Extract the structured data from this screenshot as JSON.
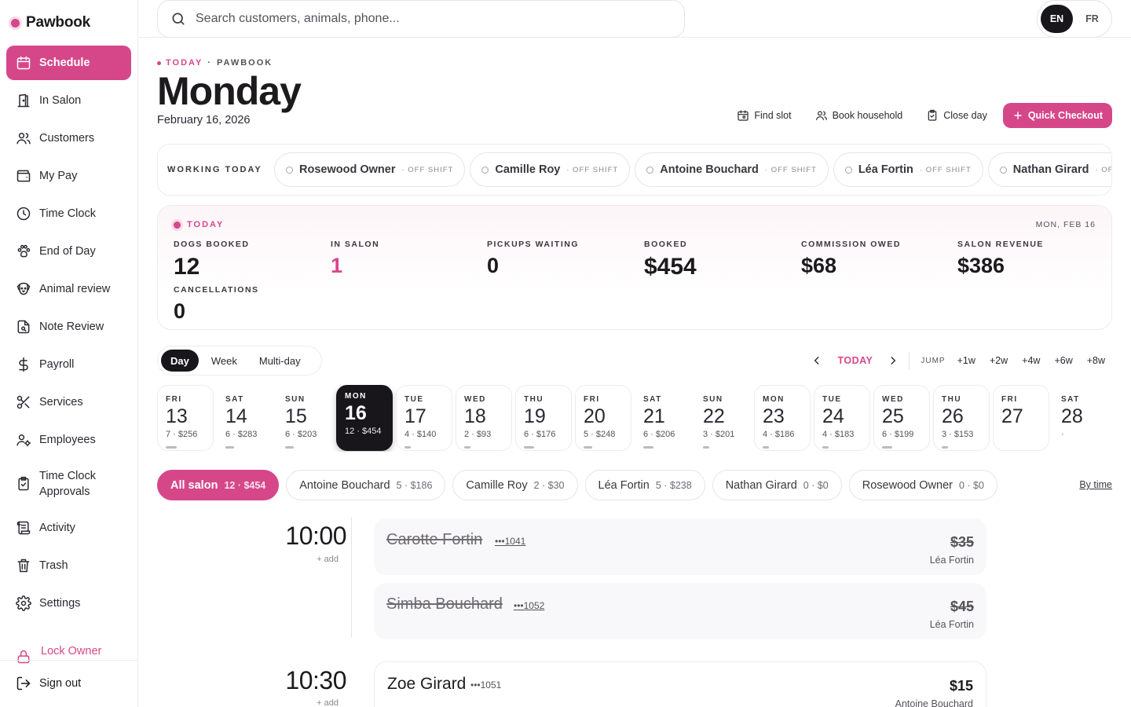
{
  "app": {
    "name": "Pawbook",
    "accent": "#d6478a"
  },
  "sidebar": {
    "items": [
      {
        "label": "Schedule",
        "icon": "calendar-icon",
        "active": true
      },
      {
        "label": "In Salon",
        "icon": "door-icon"
      },
      {
        "label": "Customers",
        "icon": "users-icon"
      },
      {
        "label": "My Pay",
        "icon": "wallet-icon"
      },
      {
        "label": "Time Clock",
        "icon": "clock-icon"
      },
      {
        "label": "End of Day",
        "icon": "paw-icon"
      },
      {
        "label": "Animal review",
        "icon": "dog-face-icon"
      },
      {
        "label": "Note Review",
        "icon": "note-icon"
      },
      {
        "label": "Payroll",
        "icon": "dollar-icon"
      },
      {
        "label": "Services",
        "icon": "scissors-icon"
      },
      {
        "label": "Employees",
        "icon": "user-gear-icon"
      },
      {
        "label": "Time Clock Approvals",
        "icon": "clipboard-check-icon"
      },
      {
        "label": "Activity",
        "icon": "activity-list-icon"
      },
      {
        "label": "Trash",
        "icon": "trash-icon"
      },
      {
        "label": "Settings",
        "icon": "gear-icon"
      }
    ],
    "lock_label": "Lock Owner",
    "signout_label": "Sign out"
  },
  "topbar": {
    "search_placeholder": "Search customers, animals, phone...",
    "lang": [
      "EN",
      "FR"
    ],
    "lang_selected": "EN"
  },
  "header": {
    "eyebrow_today": "TODAY",
    "eyebrow_sep": "·",
    "eyebrow_brand": "PAWBOOK",
    "title": "Monday",
    "date": "February 16, 2026",
    "actions": {
      "find_slot": "Find slot",
      "book_household": "Book household",
      "close_day": "Close day",
      "quick_checkout": "Quick Checkout"
    }
  },
  "working": {
    "label": "WORKING TODAY",
    "staff": [
      {
        "name": "Rosewood Owner",
        "status": "· OFF SHIFT"
      },
      {
        "name": "Camille Roy",
        "status": "· OFF SHIFT"
      },
      {
        "name": "Antoine Bouchard",
        "status": "· OFF SHIFT"
      },
      {
        "name": "Léa Fortin",
        "status": "· OFF SHIFT"
      },
      {
        "name": "Nathan Girard",
        "status": "· OFF SHIFT"
      }
    ]
  },
  "stats": {
    "label": "TODAY",
    "date": "MON, FEB 16",
    "dogs_booked": {
      "label": "DOGS BOOKED",
      "value": "12"
    },
    "in_salon": {
      "label": "IN SALON",
      "value": "1"
    },
    "pickups_waiting": {
      "label": "PICKUPS WAITING",
      "value": "0"
    },
    "booked": {
      "label": "BOOKED",
      "value": "$454"
    },
    "commission_owed": {
      "label": "COMMISSION OWED",
      "value": "$68"
    },
    "salon_revenue": {
      "label": "SALON REVENUE",
      "value": "$386"
    },
    "cancellations": {
      "label": "CANCELLATIONS",
      "value": "0"
    }
  },
  "view": {
    "modes": [
      "Day",
      "Week",
      "Multi-day"
    ],
    "selected": "Day",
    "today_label": "TODAY",
    "jump_label": "JUMP",
    "jumps": [
      "+1w",
      "+2w",
      "+4w",
      "+6w",
      "+8w"
    ]
  },
  "days": [
    {
      "dow": "FRI",
      "num": "13",
      "sum": "7 · $256",
      "load": 0.45
    },
    {
      "dow": "SAT",
      "num": "14",
      "sum": "6 · $283",
      "load": 0.35
    },
    {
      "dow": "SUN",
      "num": "15",
      "sum": "6 · $203",
      "load": 0.35
    },
    {
      "dow": "MON",
      "num": "16",
      "sum": "12 · $454",
      "selected": true,
      "load": 1.0
    },
    {
      "dow": "TUE",
      "num": "17",
      "sum": "4 · $140",
      "load": 0.25
    },
    {
      "dow": "WED",
      "num": "18",
      "sum": "2 · $93",
      "load": 0.15
    },
    {
      "dow": "THU",
      "num": "19",
      "sum": "6 · $176",
      "load": 0.4
    },
    {
      "dow": "FRI",
      "num": "20",
      "sum": "5 · $248",
      "load": 0.35
    },
    {
      "dow": "SAT",
      "num": "21",
      "sum": "6 · $206",
      "load": 0.4
    },
    {
      "dow": "SUN",
      "num": "22",
      "sum": "3 · $201",
      "load": 0.2
    },
    {
      "dow": "MON",
      "num": "23",
      "sum": "4 · $186",
      "load": 0.25
    },
    {
      "dow": "TUE",
      "num": "24",
      "sum": "4 · $183",
      "load": 0.25
    },
    {
      "dow": "WED",
      "num": "25",
      "sum": "6 · $199",
      "load": 0.4
    },
    {
      "dow": "THU",
      "num": "26",
      "sum": "3 · $153",
      "load": 0.2
    },
    {
      "dow": "FRI",
      "num": "27",
      "sum": "",
      "load": 0
    },
    {
      "dow": "SAT",
      "num": "28",
      "sum": "·",
      "load": 0
    }
  ],
  "filters": {
    "pills": [
      {
        "label": "All salon",
        "count": "12 · $454",
        "selected": true
      },
      {
        "label": "Antoine Bouchard",
        "count": "5 · $186"
      },
      {
        "label": "Camille Roy",
        "count": "2 · $30"
      },
      {
        "label": "Léa Fortin",
        "count": "5 · $238"
      },
      {
        "label": "Nathan Girard",
        "count": "0 · $0"
      },
      {
        "label": "Rosewood Owner",
        "count": "0 · $0"
      }
    ],
    "sort_label": "By time"
  },
  "timeline": {
    "slots": [
      {
        "time": "10:00",
        "add": "+ add"
      },
      {
        "time": "10:30",
        "add": "+ add"
      }
    ],
    "appointments": [
      {
        "name": "Carotte Fortin",
        "tag": "•••1041",
        "price": "$35",
        "groomer": "Léa Fortin",
        "cancelled": true
      },
      {
        "name": "Simba Bouchard",
        "tag": "•••1052",
        "price": "$45",
        "groomer": "Léa Fortin",
        "cancelled": true
      },
      {
        "name": "Zoe Girard",
        "tag": "•••1051",
        "price": "$15",
        "groomer": "Antoine Bouchard",
        "cancelled": false
      }
    ]
  }
}
